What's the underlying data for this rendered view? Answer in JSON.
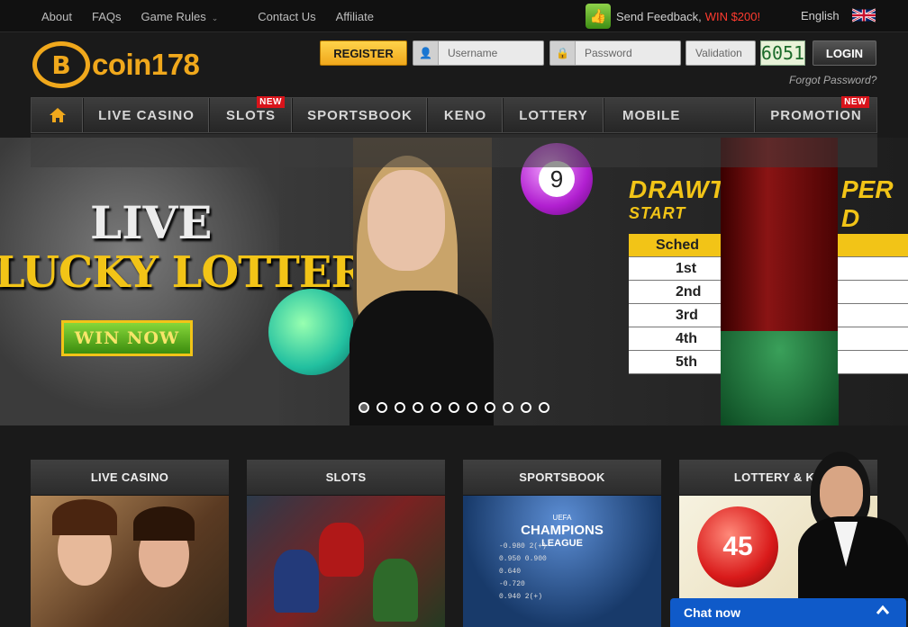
{
  "topbar": {
    "links": [
      "About",
      "FAQs",
      "Game Rules",
      "Contact Us",
      "Affiliate"
    ],
    "feedback": "Send Feedback,",
    "feedback_prize": "WIN $200!",
    "language": "English"
  },
  "header": {
    "logo_text": "coin178",
    "logo_symbol": "B",
    "register_label": "REGISTER",
    "username_placeholder": "Username",
    "password_placeholder": "Password",
    "validation_placeholder": "Validation",
    "captcha_code": "6051",
    "login_label": "LOGIN",
    "forgot_password": "Forgot Password?"
  },
  "nav": {
    "items": [
      "LIVE CASINO",
      "SLOTS",
      "SPORTSBOOK",
      "KENO",
      "LOTTERY",
      "MOBILE",
      "PROMOTION"
    ],
    "new_badge": "NEW"
  },
  "banner": {
    "live": "LIVE",
    "lucky_lottery": "LUCKY LOTTERY",
    "win_now": "WIN NOW",
    "ball_number": "9",
    "draw_title": "DRAWT",
    "draw_title_right": "PER D",
    "start_text": "START",
    "table_header": "Sched",
    "table_rows": [
      "1st",
      "2nd",
      "3rd",
      "4th",
      "5th"
    ],
    "slide_count": 11,
    "active_slide": 1
  },
  "categories": [
    "LIVE CASINO",
    "SLOTS",
    "SPORTSBOOK",
    "LOTTERY & KE"
  ],
  "sportsbook_card": {
    "ucl_top": "UEFA",
    "ucl_title": "CHAMPIONS",
    "ucl_sub": "LEAGUE",
    "odds_rows": [
      "-0.980  2(+)",
      "0.950  0.900",
      "0.640",
      "-0.720",
      "0.940  2(+)"
    ]
  },
  "lottery_card": {
    "ball": "45"
  },
  "chat": {
    "label": "Chat now"
  },
  "colors": {
    "accent": "#f0a81c",
    "badge": "#d9131a",
    "chat": "#0f5ac9",
    "prize": "#ff3b2f"
  }
}
